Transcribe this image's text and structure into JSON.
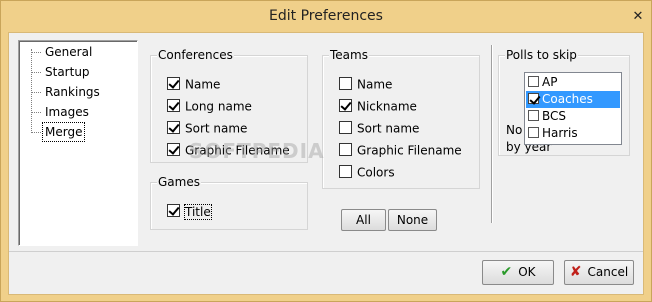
{
  "window": {
    "title": "Edit Preferences",
    "close_glyph": "✕"
  },
  "tree": {
    "items": [
      "General",
      "Startup",
      "Rankings",
      "Images",
      "Merge"
    ]
  },
  "conferences": {
    "label": "Conferences",
    "options": [
      {
        "label": "Name",
        "checked": true
      },
      {
        "label": "Long name",
        "checked": true
      },
      {
        "label": "Sort name",
        "checked": true
      },
      {
        "label": "Graphic Filename",
        "checked": true
      }
    ]
  },
  "teams": {
    "label": "Teams",
    "options": [
      {
        "label": "Name",
        "checked": false
      },
      {
        "label": "Nickname",
        "checked": true
      },
      {
        "label": "Sort name",
        "checked": false
      },
      {
        "label": "Graphic Filename",
        "checked": false
      },
      {
        "label": "Colors",
        "checked": false
      }
    ]
  },
  "games": {
    "label": "Games",
    "options": [
      {
        "label": "Title",
        "checked": true
      }
    ]
  },
  "buttons": {
    "all": "All",
    "none": "None",
    "ok": "OK",
    "cancel": "Cancel"
  },
  "polls": {
    "label": "Polls to skip",
    "items": [
      {
        "label": "AP",
        "checked": false,
        "selected": false
      },
      {
        "label": "Coaches",
        "checked": true,
        "selected": true
      },
      {
        "label": "BCS",
        "checked": false,
        "selected": false
      },
      {
        "label": "Harris",
        "checked": false,
        "selected": false
      }
    ],
    "obscured_text_1": "No",
    "obscured_text_2": "by year"
  },
  "watermark": "SOFTPEDIA",
  "icons": {
    "ok": "check-icon",
    "cancel": "x-icon"
  },
  "colors": {
    "titlebar": "#f0d08a",
    "selection": "#3399ff",
    "ok_icon": "#2a9a2a",
    "cancel_icon": "#c0201a"
  }
}
